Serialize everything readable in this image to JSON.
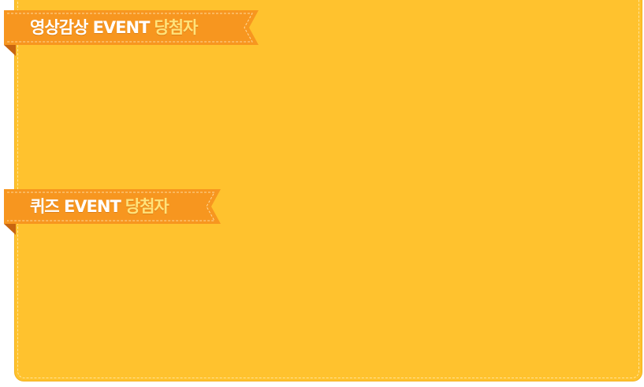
{
  "sections": [
    {
      "label": "영상감상 EVENT",
      "suffix": "당첨자"
    },
    {
      "label": "퀴즈 EVENT",
      "suffix": "당첨자"
    }
  ],
  "colors": {
    "panel": "#ffc22e",
    "ribbon": "#f7961f",
    "ribbon_fold": "#c8650f",
    "label_text": "#ffffff",
    "suffix_text": "#ffe27a"
  }
}
